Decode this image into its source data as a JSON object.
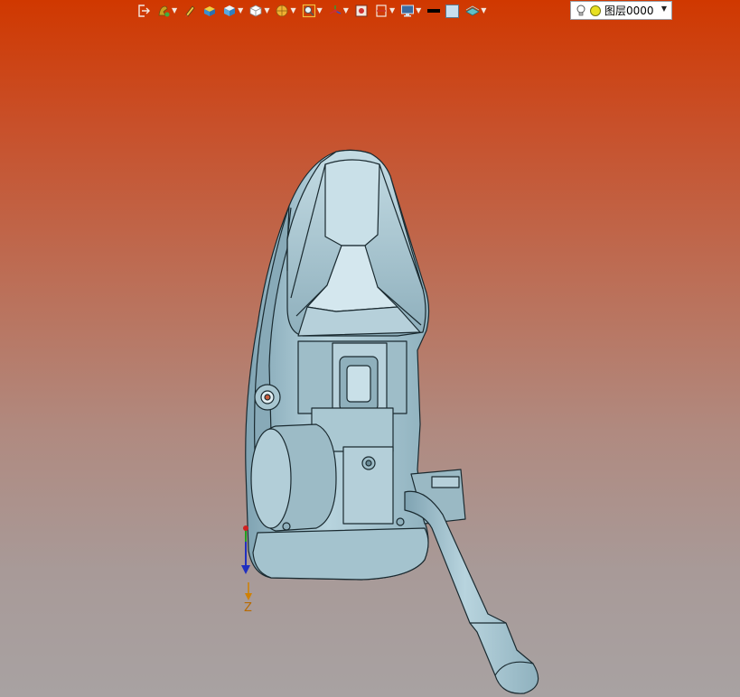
{
  "toolbar": {
    "items": [
      {
        "icon": "exit-icon",
        "has_dropdown": false
      },
      {
        "icon": "snap-icon",
        "has_dropdown": true
      },
      {
        "icon": "pen-icon",
        "has_dropdown": false
      },
      {
        "icon": "solid-box-icon",
        "has_dropdown": false
      },
      {
        "icon": "view-cube-icon",
        "has_dropdown": true
      },
      {
        "icon": "wireframe-cube-icon",
        "has_dropdown": true
      },
      {
        "icon": "render-sphere-icon",
        "has_dropdown": true
      },
      {
        "icon": "zoom-fit-icon",
        "has_dropdown": true
      },
      {
        "icon": "axis-triad-icon",
        "has_dropdown": true
      },
      {
        "icon": "frame-icon",
        "has_dropdown": false
      },
      {
        "icon": "section-icon",
        "has_dropdown": true
      },
      {
        "icon": "monitor-icon",
        "has_dropdown": true
      },
      {
        "icon": "line-color-icon",
        "has_dropdown": false
      },
      {
        "icon": "fill-color-icon",
        "has_dropdown": false
      },
      {
        "icon": "layer-plane-icon",
        "has_dropdown": true
      }
    ],
    "layer": {
      "label": "图层0000",
      "bulb_icon": "light-bulb-icon",
      "color": "#e8e020"
    }
  },
  "viewport": {
    "axis_label": "Z",
    "model_color": "#a6c6d2",
    "edge_color": "#1a2a30"
  }
}
